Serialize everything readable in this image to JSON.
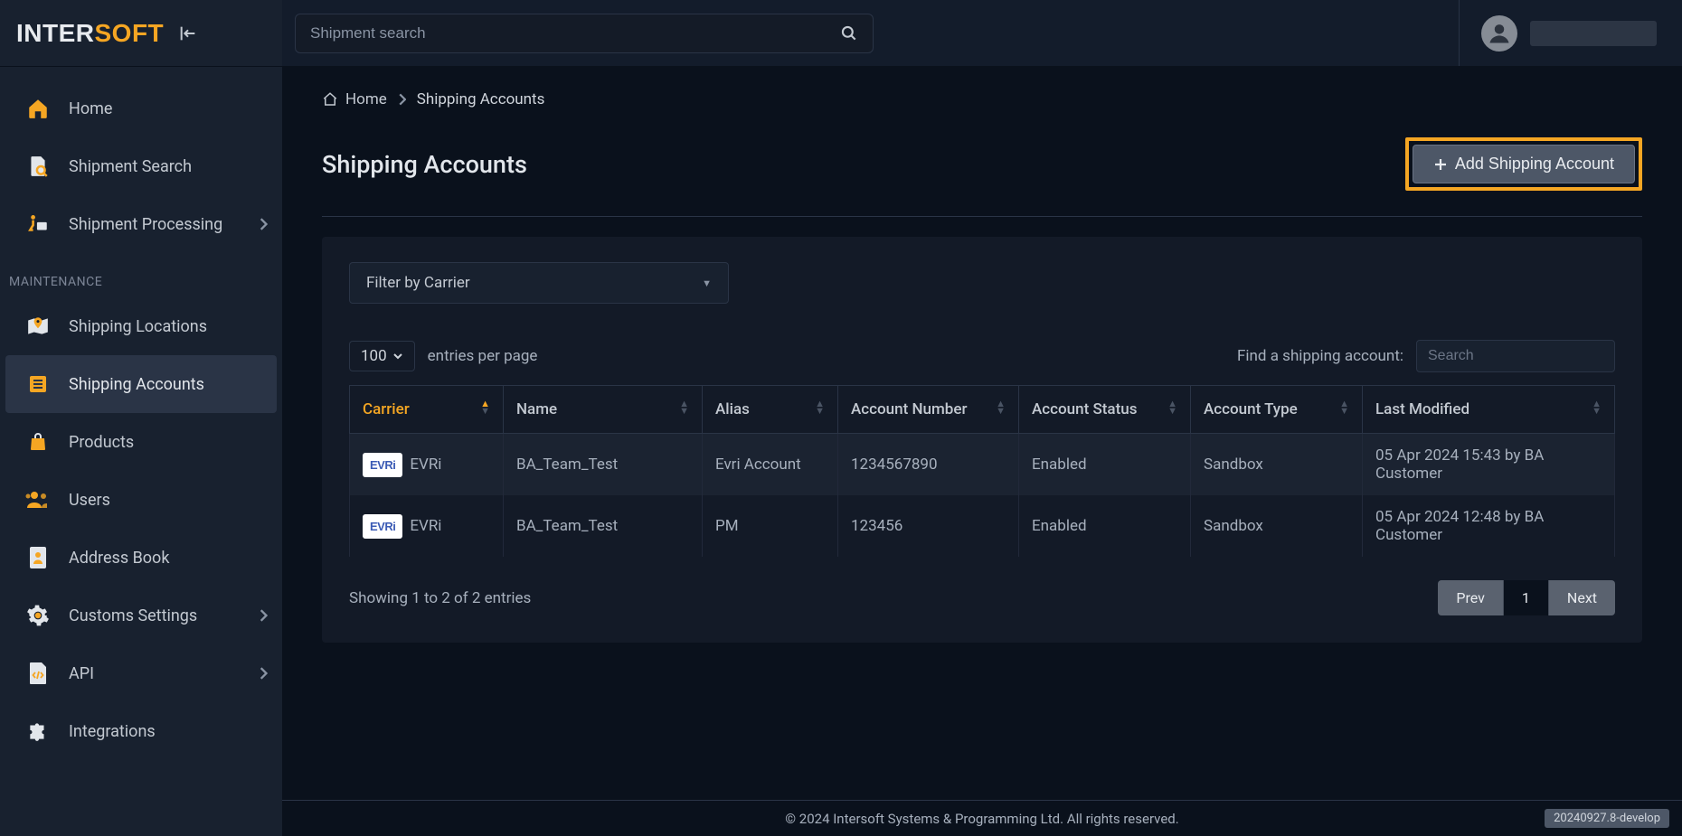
{
  "brand": {
    "part1": "INTER",
    "part2": "SOFT"
  },
  "search": {
    "placeholder": "Shipment search"
  },
  "sidebar": {
    "items": [
      {
        "label": "Home",
        "icon": "home"
      },
      {
        "label": "Shipment Search",
        "icon": "doc-search"
      },
      {
        "label": "Shipment Processing",
        "icon": "processing",
        "expandable": true
      }
    ],
    "section_label": "MAINTENANCE",
    "maintenance": [
      {
        "label": "Shipping Locations",
        "icon": "map-pin"
      },
      {
        "label": "Shipping Accounts",
        "icon": "list",
        "active": true
      },
      {
        "label": "Products",
        "icon": "bag"
      },
      {
        "label": "Users",
        "icon": "users"
      },
      {
        "label": "Address Book",
        "icon": "contact"
      },
      {
        "label": "Customs Settings",
        "icon": "gear",
        "expandable": true
      },
      {
        "label": "API",
        "icon": "code-doc",
        "expandable": true
      },
      {
        "label": "Integrations",
        "icon": "puzzle"
      }
    ]
  },
  "breadcrumb": {
    "home": "Home",
    "current": "Shipping Accounts"
  },
  "page": {
    "title": "Shipping Accounts",
    "add_button": "Add Shipping Account"
  },
  "filter": {
    "label": "Filter by Carrier"
  },
  "table": {
    "page_size": "100",
    "entries_label": "entries per page",
    "find_label": "Find a shipping account:",
    "search_placeholder": "Search",
    "columns": [
      "Carrier",
      "Name",
      "Alias",
      "Account Number",
      "Account Status",
      "Account Type",
      "Last Modified"
    ],
    "rows": [
      {
        "carrier_badge": "EVRi",
        "carrier": "EVRi",
        "name": "BA_Team_Test",
        "alias": "Evri Account",
        "account_number": "1234567890",
        "status": "Enabled",
        "type": "Sandbox",
        "modified": "05 Apr 2024 15:43 by BA Customer"
      },
      {
        "carrier_badge": "EVRi",
        "carrier": "EVRi",
        "name": "BA_Team_Test",
        "alias": "PM",
        "account_number": "123456",
        "status": "Enabled",
        "type": "Sandbox",
        "modified": "05 Apr 2024 12:48 by BA Customer"
      }
    ],
    "showing": "Showing 1 to 2 of 2 entries",
    "prev": "Prev",
    "page": "1",
    "next": "Next"
  },
  "footer": {
    "copyright": "© 2024 Intersoft Systems & Programming Ltd. All rights reserved.",
    "build": "20240927.8-develop"
  }
}
